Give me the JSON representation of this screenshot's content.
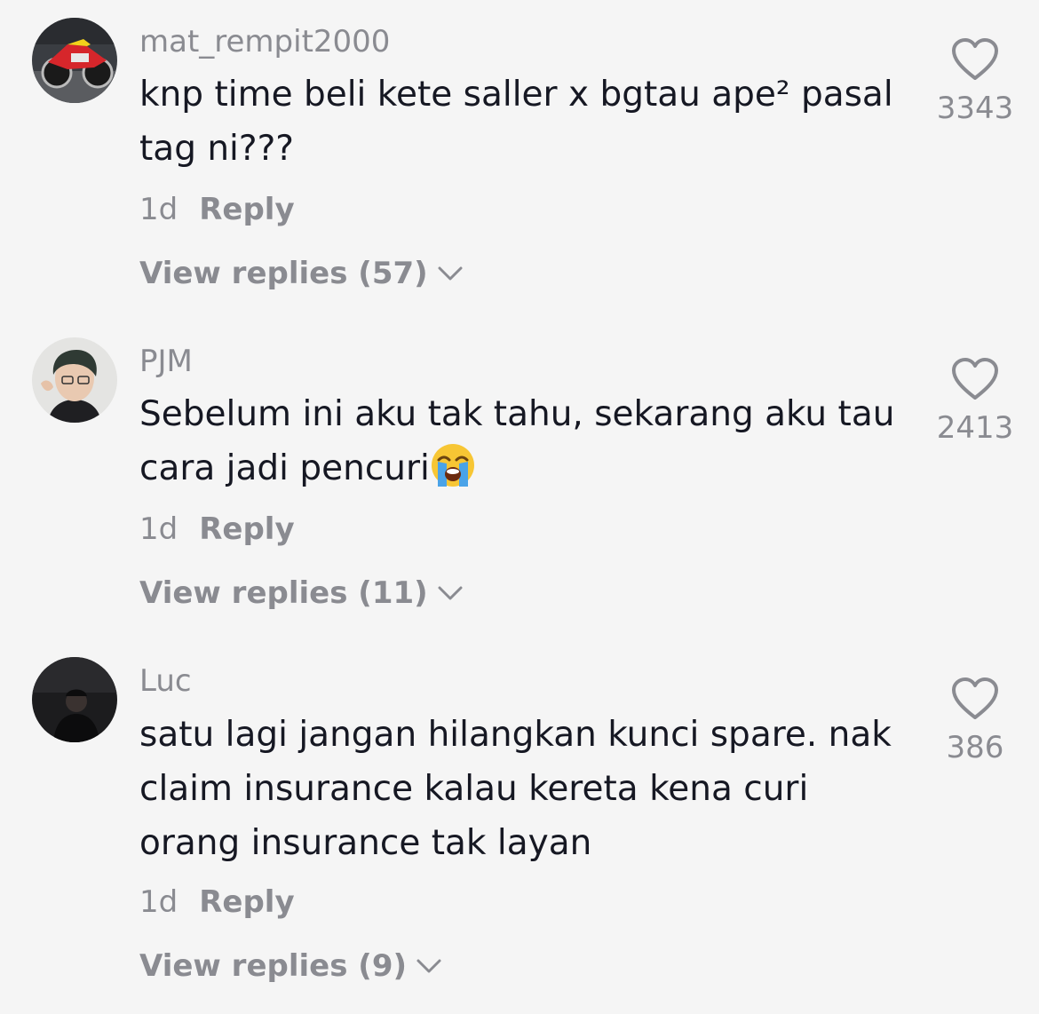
{
  "comments": [
    {
      "username": "mat_rempit2000",
      "text": "knp time beli kete saller x bgtau ape² pasal tag ni???",
      "time": "1d",
      "reply_label": "Reply",
      "view_replies": "View replies (57)",
      "likes": "3343",
      "avatar": "motorcycle-avatar"
    },
    {
      "username": "PJM",
      "text": "Sebelum ini aku tak tahu, sekarang aku tau cara jadi pencuri",
      "emoji": "loudly-crying-face",
      "time": "1d",
      "reply_label": "Reply",
      "view_replies": "View replies (11)",
      "likes": "2413",
      "avatar": "person-avatar"
    },
    {
      "username": "Luc",
      "text": "satu lagi jangan hilangkan kunci spare. nak claim insurance kalau kereta kena curi orang insurance tak layan",
      "time": "1d",
      "reply_label": "Reply",
      "view_replies": "View replies (9)",
      "likes": "386",
      "avatar": "dark-silhouette-avatar"
    }
  ],
  "icons": {
    "like": "heart-outline-icon",
    "expand": "chevron-down-icon"
  },
  "colors": {
    "background": "#f5f5f5",
    "primary_text": "#161823",
    "secondary_text": "#8a8b91"
  }
}
